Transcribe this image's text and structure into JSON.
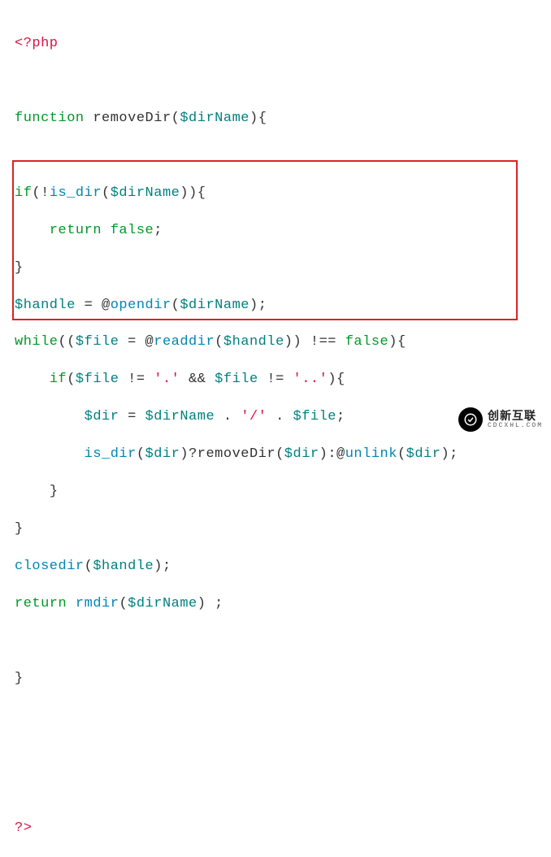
{
  "tokens": {
    "php_open": "<?php",
    "php_close": "?>",
    "kw_function": "function",
    "kw_if": "if",
    "kw_return": "return",
    "kw_while": "while",
    "fn_removeDir": "removeDir",
    "fn_is_dir": "is_dir",
    "fn_opendir": "opendir",
    "fn_readdir": "readdir",
    "fn_closedir": "closedir",
    "fn_rmdir": "rmdir",
    "fn_unlink": "unlink",
    "var_dirName": "$dirName",
    "var_handle": "$handle",
    "var_file": "$file",
    "var_dir": "$dir",
    "str_dot": "'.'",
    "str_dotdot": "'..'",
    "str_slash": "'/'",
    "lit_false": "false",
    "p_lp": "(",
    "p_rp": ")",
    "p_lb": "{",
    "p_rb": "}",
    "p_semi": ";",
    "p_bang": "!",
    "p_eq": "=",
    "p_at": "@",
    "p_neq3": "!==",
    "p_neq": "!=",
    "p_and": "&&",
    "p_dot": ".",
    "p_q": "?",
    "p_colon": ":",
    "p_sp": " "
  },
  "watermark": {
    "text": "创新互联",
    "sub": "CDCXHL.COM"
  }
}
